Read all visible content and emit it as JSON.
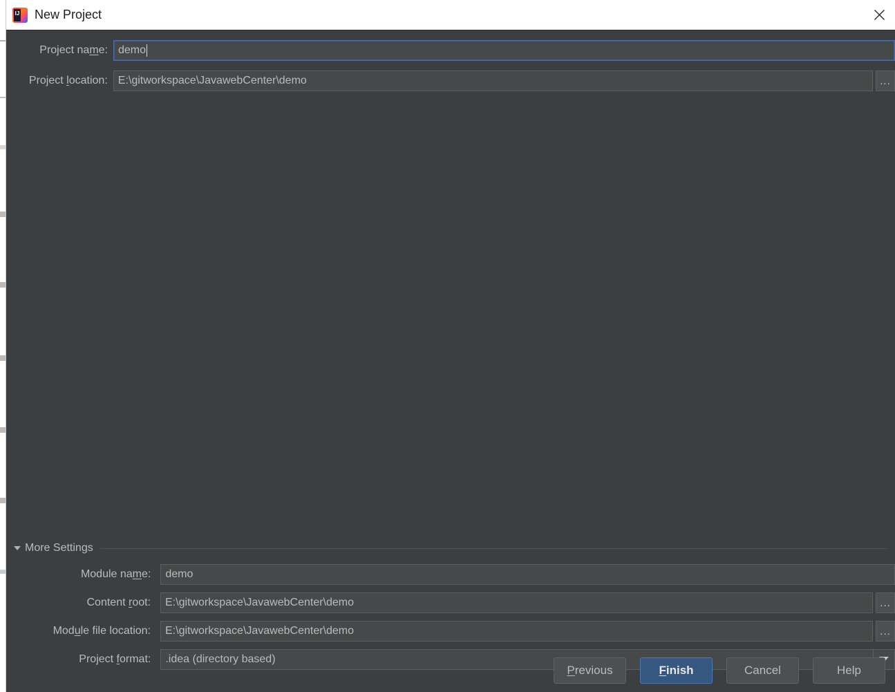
{
  "window": {
    "title": "New Project",
    "icon": "intellij-idea-icon",
    "close_label": "close-icon"
  },
  "main": {
    "project_name": {
      "label_pre": "Project na",
      "label_mnemonic": "m",
      "label_post": "e:",
      "value": "demo",
      "focused": true
    },
    "project_location": {
      "label_pre": "Project ",
      "label_mnemonic": "l",
      "label_post": "ocation:",
      "value": "E:\\gitworkspace\\JavawebCenter\\demo",
      "browse_label": "..."
    }
  },
  "more_settings": {
    "header": "More Settings",
    "expanded": true,
    "fields": [
      {
        "name": "module-name",
        "label_pre": "Module na",
        "label_mnemonic": "m",
        "label_post": "e:",
        "value": "demo",
        "has_browse": false,
        "type": "text"
      },
      {
        "name": "content-root",
        "label_pre": "Content ",
        "label_mnemonic": "r",
        "label_post": "oot:",
        "value": "E:\\gitworkspace\\JavawebCenter\\demo",
        "has_browse": true,
        "browse_label": "...",
        "type": "text"
      },
      {
        "name": "module-file-location",
        "label_pre": "Mod",
        "label_mnemonic": "u",
        "label_post": "le file location:",
        "value": "E:\\gitworkspace\\JavawebCenter\\demo",
        "has_browse": true,
        "browse_label": "...",
        "type": "text"
      },
      {
        "name": "project-format",
        "label_pre": "Project ",
        "label_mnemonic": "f",
        "label_post": "ormat:",
        "value": ".idea (directory based)",
        "has_browse": false,
        "type": "combobox"
      }
    ]
  },
  "buttons": [
    {
      "name": "previous",
      "pre": "",
      "mnemonic": "P",
      "post": "revious",
      "default": false
    },
    {
      "name": "finish",
      "pre": "",
      "mnemonic": "F",
      "post": "inish",
      "default": true
    },
    {
      "name": "cancel",
      "pre": "Cancel",
      "mnemonic": "",
      "post": "",
      "default": false
    },
    {
      "name": "help",
      "pre": "Help",
      "mnemonic": "",
      "post": "",
      "default": false
    }
  ],
  "colors": {
    "dialog_bg": "#3c3f41",
    "titlebar_bg": "#ffffff",
    "field_bg": "#45494a",
    "text": "#bbbbbb",
    "accent": "#365880",
    "focus_border": "#4b6eaf"
  }
}
